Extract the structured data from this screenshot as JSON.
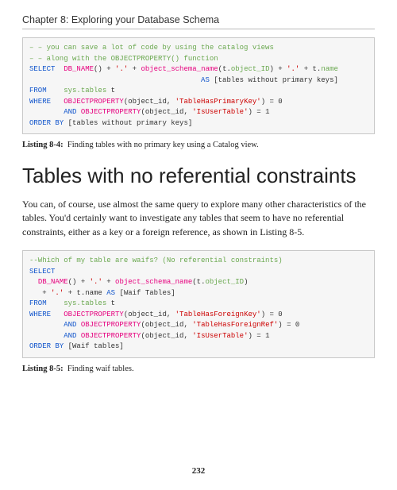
{
  "chapter": "Chapter 8: Exploring your Database Schema",
  "code1": {
    "comment1": "– – you can save a lot of code by using the catalog views",
    "comment2": "– – along with the OBJECTPROPERTY() function",
    "kw_select": "SELECT",
    "f_dbname": "DB_NAME",
    "p1": "() + ",
    "s_dot1": "'.'",
    "p2": " + ",
    "f_osn": "object_schema_name",
    "p3": "(t.",
    "objid": "object_ID",
    "p4": ") + ",
    "s_dot2": "'.'",
    "p5": " + t.",
    "name": "name",
    "kw_as": "AS",
    "alias": " [tables without primary keys]",
    "kw_from": "FROM",
    "tbl": "sys.tables",
    "t": " t",
    "kw_where": "WHERE",
    "f_op": "OBJECTPROPERTY",
    "p6": "(object_id, ",
    "s_haspk": "'TableHasPrimaryKey'",
    "p7": ") = 0",
    "kw_and": "AND",
    "p8": "(object_id, ",
    "s_isuser": "'IsUserTable'",
    "p9": ") = 1",
    "kw_orderby": "ORDER BY",
    "ob": " [tables without primary keys]"
  },
  "caption1_label": "Listing 8-4:",
  "caption1_text": "Finding tables with no primary key using a Catalog view.",
  "heading": "Tables with no referential constraints",
  "body": "You can, of course, use almost the same query to explore many other characteristics of the tables. You'd certainly want to investigate any tables that seem to have no referential constraints, either as a key or a foreign reference, as shown in Listing 8-5.",
  "code2": {
    "comment": "--Which of my table are waifs? (No referential constraints)",
    "kw_select": "SELECT",
    "f_dbname": "DB_NAME",
    "p1": "() + ",
    "s_dot1": "'.'",
    "p2": " + ",
    "f_osn": "object_schema_name",
    "p3": "(t.",
    "objid": "object_ID",
    "p4": ")",
    "p5": "   + ",
    "s_dot2": "'.'",
    "p6": " + t.name ",
    "kw_as": "AS",
    "alias": " [Waif Tables]",
    "kw_from": "FROM",
    "tbl": "sys.tables",
    "t": " t",
    "kw_where": "WHERE",
    "f_op": "OBJECTPROPERTY",
    "p7": "(object_id, ",
    "s_hasfk": "'TableHasForeignKey'",
    "p8": ") = 0",
    "kw_and": "AND",
    "p9": "(object_id, ",
    "s_hasfref": "'TableHasForeignRef'",
    "p10": ") = 0",
    "p11": "(object_id, ",
    "s_isuser": "'IsUserTable'",
    "p12": ") = 1",
    "kw_orderby": "ORDER BY",
    "ob": " [Waif tables]"
  },
  "caption2_label": "Listing 8-5:",
  "caption2_text": "Finding waif tables.",
  "page_number": "232"
}
